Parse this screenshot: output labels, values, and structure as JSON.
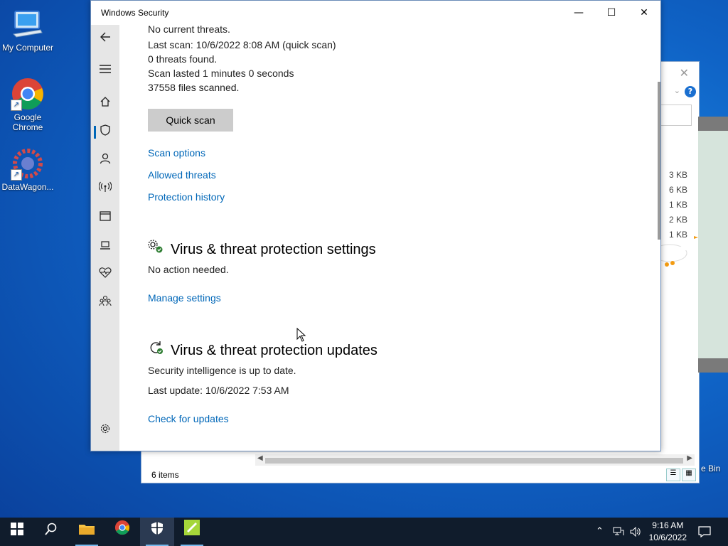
{
  "desktop": {
    "icons": [
      {
        "label": "My Computer"
      },
      {
        "label": "Google Chrome"
      },
      {
        "label": "DataWagon..."
      }
    ],
    "recycle_bin_label": "e Bin"
  },
  "explorer": {
    "file_sizes": [
      "3 KB",
      "6 KB",
      "1 KB",
      "2 KB",
      "1 KB"
    ],
    "items_count": "6 items"
  },
  "window": {
    "title": "Windows Security",
    "controls": {
      "minimize": "—",
      "maximize": "☐",
      "close": "✕"
    }
  },
  "scan_status": {
    "current": "No current threats.",
    "last_scan": "Last scan: 10/6/2022 8:08 AM (quick scan)",
    "threats_found": "0 threats found.",
    "duration": "Scan lasted 1 minutes 0 seconds",
    "files_scanned": "37558 files scanned.",
    "quick_scan_label": "Quick scan",
    "links": [
      "Scan options",
      "Allowed threats",
      "Protection history"
    ]
  },
  "settings_section": {
    "title": "Virus & threat protection settings",
    "status": "No action needed.",
    "link": "Manage settings"
  },
  "updates_section": {
    "title": "Virus & threat protection updates",
    "status": "Security intelligence is up to date.",
    "last_update": "Last update: 10/6/2022 7:53 AM",
    "link": "Check for updates"
  },
  "sidebar": {
    "items": [
      {
        "icon": "back-arrow-icon"
      },
      {
        "icon": "hamburger-menu-icon"
      },
      {
        "icon": "home-icon"
      },
      {
        "icon": "shield-icon",
        "active": true
      },
      {
        "icon": "person-icon"
      },
      {
        "icon": "wireless-icon"
      },
      {
        "icon": "app-browser-icon"
      },
      {
        "icon": "laptop-icon"
      },
      {
        "icon": "heart-pulse-icon"
      },
      {
        "icon": "family-icon"
      },
      {
        "icon": "gear-icon"
      }
    ]
  },
  "taskbar": {
    "time": "9:16 AM",
    "date": "10/6/2022"
  },
  "colors": {
    "accent": "#0067b8",
    "taskbar": "#101c2c",
    "sidebar": "#e6e6e6"
  }
}
